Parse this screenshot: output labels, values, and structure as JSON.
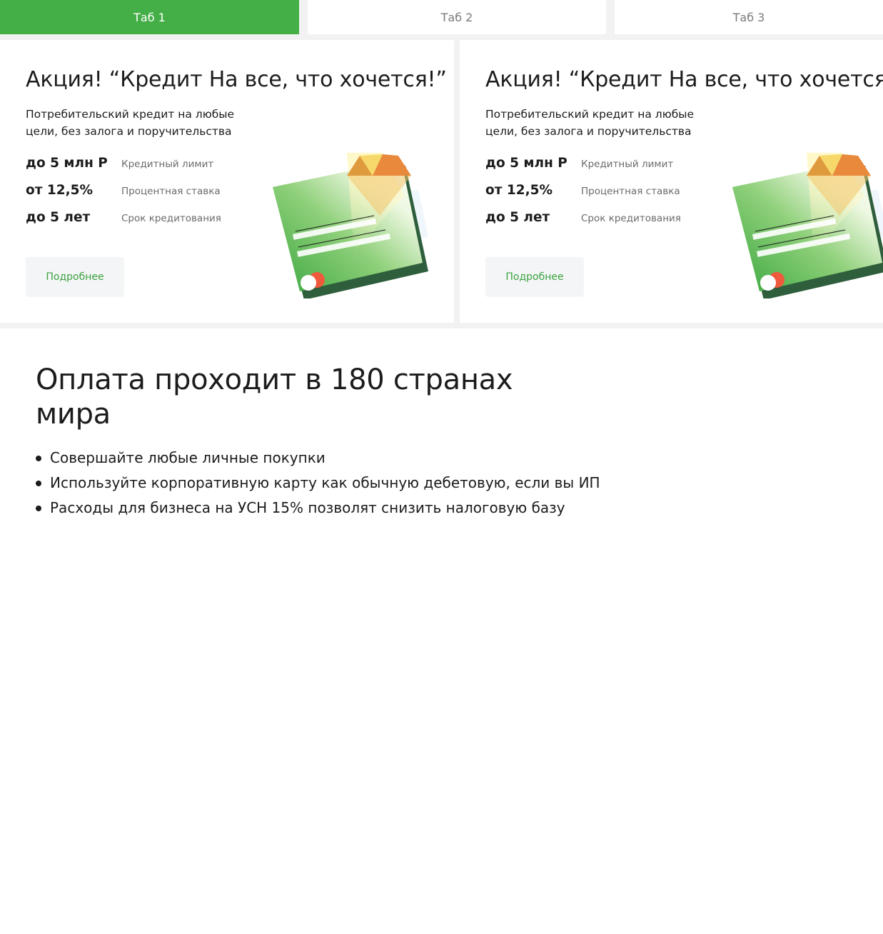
{
  "tabs": [
    {
      "label": "Таб 1",
      "active": true
    },
    {
      "label": "Таб 2",
      "active": false
    },
    {
      "label": "Таб 3",
      "active": false
    }
  ],
  "promos": [
    {
      "title": "Акция! “Кредит На все, что хочется!”",
      "description": "Потребительский кредит на любые цели, без залога и поручительства",
      "stats": [
        {
          "value": "до 5 млн Р",
          "label": "Кредитный лимит"
        },
        {
          "value": "от 12,5%",
          "label": "Процентная ставка"
        },
        {
          "value": "до 5 лет",
          "label": "Срок кредитования"
        }
      ],
      "button_label": "Подробнее"
    },
    {
      "title": "Акция! “Кредит На все, что хочется!”",
      "description": "Потребительский кредит на любые цели, без залога и поручительства",
      "stats": [
        {
          "value": "до 5 млн Р",
          "label": "Кредитный лимит"
        },
        {
          "value": "от 12,5%",
          "label": "Процентная ставка"
        },
        {
          "value": "до 5 лет",
          "label": "Срок кредитования"
        }
      ],
      "button_label": "Подробнее"
    }
  ],
  "payment": {
    "title": "Оплата проходит в 180 странах мира",
    "bullets": [
      "Совершайте любые личные покупки",
      "Используйте корпоративную карту как обычную дебетовую, если вы ИП",
      "Расходы для бизнеса на УСН 15% позволят снизить налоговую базу"
    ]
  },
  "colors": {
    "accent_green": "#44ae47",
    "link_green": "#3ba23f",
    "page_gray": "#f2f2f2",
    "button_bg": "#f4f5f7"
  },
  "icons": {
    "card_illustration": "credit-card-with-diamond-illustration"
  }
}
